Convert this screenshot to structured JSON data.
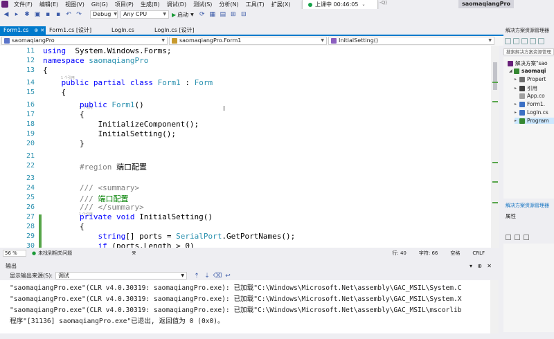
{
  "menu": {
    "items": [
      "文件(F)",
      "编辑(E)",
      "视图(V)",
      "Git(G)",
      "项目(P)",
      "生成(B)",
      "调试(D)",
      "测试(S)",
      "分析(N)",
      "工具(T)",
      "扩展(X)"
    ],
    "live_label": "上课中 00:46:05",
    "search_hint": "-Q)",
    "project_name": "saomaqiangPro"
  },
  "toolbar": {
    "config": "Debug",
    "platform": "Any CPU",
    "start_label": "启动"
  },
  "tabs": [
    {
      "label": "Form1.cs",
      "active": true
    },
    {
      "label": "Form1.cs [设计]",
      "active": false
    },
    {
      "label": "LogIn.cs",
      "active": false
    },
    {
      "label": "LogIn.cs [设计]",
      "active": false
    }
  ],
  "nav": {
    "project": "saomaqiangPro",
    "class": "saomaqiangPro.Form1",
    "member": "InitialSetting()"
  },
  "editor": {
    "refs_label": "1 个引用",
    "lines": [
      {
        "n": "11",
        "parts": [
          [
            "kw",
            "using"
          ],
          [
            "",
            "  System.Windows.Forms;"
          ]
        ]
      },
      {
        "n": "12",
        "parts": [
          [
            "kw",
            "namespace"
          ],
          [
            "",
            " "
          ],
          [
            "ty",
            "saomaqiangPro"
          ]
        ]
      },
      {
        "n": "13",
        "parts": [
          [
            "",
            "{"
          ]
        ]
      },
      {
        "n": "14",
        "parts": [
          [
            "",
            "    "
          ],
          [
            "kw",
            "public partial class"
          ],
          [
            "",
            " "
          ],
          [
            "ty",
            "Form1"
          ],
          [
            "",
            " : "
          ],
          [
            "ty",
            "Form"
          ]
        ]
      },
      {
        "n": "15",
        "parts": [
          [
            "",
            "    {"
          ]
        ]
      },
      {
        "n": "16",
        "parts": [
          [
            "",
            "        "
          ],
          [
            "kw",
            "public"
          ],
          [
            "",
            " "
          ],
          [
            "ty",
            "Form1"
          ],
          [
            "",
            "()"
          ]
        ]
      },
      {
        "n": "17",
        "parts": [
          [
            "",
            "        {"
          ]
        ]
      },
      {
        "n": "18",
        "parts": [
          [
            "",
            "            InitializeComponent();"
          ]
        ]
      },
      {
        "n": "19",
        "parts": [
          [
            "",
            "            InitialSetting();"
          ]
        ]
      },
      {
        "n": "20",
        "parts": [
          [
            "",
            "        }"
          ]
        ]
      },
      {
        "n": "21",
        "parts": [
          [
            "",
            ""
          ]
        ]
      },
      {
        "n": "22",
        "parts": [
          [
            "",
            "        "
          ],
          [
            "rg",
            "#region"
          ],
          [
            "",
            " 端口配置"
          ]
        ]
      },
      {
        "n": "23",
        "parts": [
          [
            "",
            ""
          ]
        ]
      },
      {
        "n": "24",
        "parts": [
          [
            "",
            "        "
          ],
          [
            "rg",
            "///"
          ],
          [
            "cm",
            " "
          ],
          [
            "rg",
            "<summary>"
          ]
        ]
      },
      {
        "n": "25",
        "parts": [
          [
            "",
            "        "
          ],
          [
            "rg",
            "///"
          ],
          [
            "cm",
            " 端口配置"
          ]
        ]
      },
      {
        "n": "26",
        "parts": [
          [
            "",
            "        "
          ],
          [
            "rg",
            "///"
          ],
          [
            "cm",
            " "
          ],
          [
            "rg",
            "</summary>"
          ]
        ]
      },
      {
        "n": "27",
        "parts": [
          [
            "",
            "        "
          ],
          [
            "kw",
            "private void"
          ],
          [
            "",
            " InitialSetting()"
          ]
        ]
      },
      {
        "n": "28",
        "parts": [
          [
            "",
            "        {"
          ]
        ]
      },
      {
        "n": "29",
        "parts": [
          [
            "",
            "            "
          ],
          [
            "kw",
            "string"
          ],
          [
            "",
            "[] ports = "
          ],
          [
            "ty",
            "SerialPort"
          ],
          [
            "",
            ".GetPortNames();"
          ]
        ]
      },
      {
        "n": "30",
        "parts": [
          [
            "",
            "            "
          ],
          [
            "kw",
            "if"
          ],
          [
            "",
            " (ports.Length > 0)"
          ]
        ]
      }
    ]
  },
  "status": {
    "zoom": "56 %",
    "issues": "未找到相关问题",
    "row": "行: 40",
    "col": "字符: 66",
    "space": "空格",
    "eol": "CRLF"
  },
  "output": {
    "title": "输出",
    "source_label": "显示输出来源(S):",
    "source_value": "调试",
    "lines": [
      "\"saomaqiangPro.exe\"(CLR v4.0.30319: saomaqiangPro.exe): 已加载\"C:\\Windows\\Microsoft.Net\\assembly\\GAC_MSIL\\System.C",
      "\"saomaqiangPro.exe\"(CLR v4.0.30319: saomaqiangPro.exe): 已加载\"C:\\Windows\\Microsoft.Net\\assembly\\GAC_MSIL\\System.X",
      "\"saomaqiangPro.exe\"(CLR v4.0.30319: saomaqiangPro.exe): 已加载\"C:\\Windows\\Microsoft.Net\\assembly\\GAC_MSIL\\mscorlib",
      "程序\"[31136] saomaqiangPro.exe\"已退出, 返回值为 0 (0x0)。"
    ]
  },
  "solution": {
    "title": "解决方案资源管理器",
    "search": "搜索解决方案资源管理",
    "items": [
      {
        "label": "解决方案\"sao",
        "indent": 0,
        "arrow": ""
      },
      {
        "label": "saomaqi",
        "indent": 1,
        "arrow": "◢",
        "bold": true
      },
      {
        "label": "Propert",
        "indent": 2,
        "arrow": "▸"
      },
      {
        "label": "引用",
        "indent": 2,
        "arrow": "▸"
      },
      {
        "label": "App.co",
        "indent": 2,
        "arrow": ""
      },
      {
        "label": "Form1.",
        "indent": 2,
        "arrow": "▸"
      },
      {
        "label": "LogIn.cs",
        "indent": 2,
        "arrow": "▸"
      },
      {
        "label": "Program",
        "indent": 2,
        "arrow": "▸",
        "selected": true
      }
    ],
    "footer": "解决方案资源管理器",
    "properties": "属性"
  },
  "colors": {
    "accent": "#007acc",
    "keyword": "#0000ff",
    "type": "#2b91af",
    "comment": "#008000",
    "region": "#808080"
  }
}
